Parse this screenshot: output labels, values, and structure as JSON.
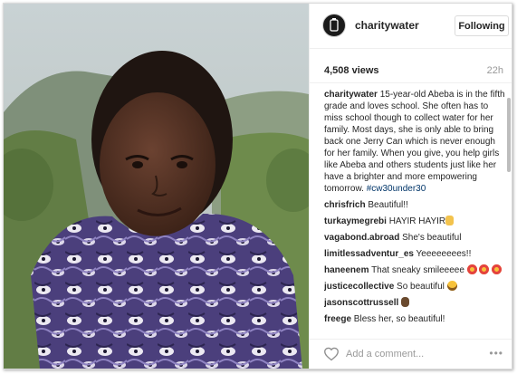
{
  "post": {
    "username": "charitywater",
    "follow_label": "Following",
    "views": "4,508 views",
    "time": "22h",
    "caption_user": "charitywater",
    "caption_text": "15-year-old Abeba is in the fifth grade and loves school. She often has to miss school though to collect water for her family. Most days, she is only able to bring back one Jerry Can which is never enough for her family. When you give, you help girls like Abeba and others students just like her have a brighter and more empowering tomorrow.",
    "caption_hashtag": "#cw30under30"
  },
  "comments": [
    {
      "user": "chrisfrich",
      "text": "Beautiful!!",
      "emoji": ""
    },
    {
      "user": "turkaymegrebi",
      "text": "HAYIR HAYIR",
      "emoji": "hand-emoji"
    },
    {
      "user": "vagabond.abroad",
      "text": "She's beautiful",
      "emoji": ""
    },
    {
      "user": "limitlessadventur_es",
      "text": "Yeeeeeeees!!",
      "emoji": ""
    },
    {
      "user": "haneenem",
      "text": "That sneaky smileeeee",
      "emoji": "heart-eyes-emoji"
    },
    {
      "user": "justicecollective",
      "text": "So beautiful",
      "emoji": "grin-emoji"
    },
    {
      "user": "jasonscottrussell",
      "text": "",
      "emoji": "ok-hand-emoji"
    },
    {
      "user": "freege",
      "text": "Bless her, so beautiful!",
      "emoji": ""
    }
  ],
  "footer": {
    "add_comment_placeholder": "Add a comment...",
    "more_label": "•••"
  },
  "icons": {
    "like": "heart-outline-icon",
    "more": "ellipsis-icon",
    "avatar": "jerry-can-logo"
  },
  "colors": {
    "hashtag": "#003569",
    "border": "#dbdbdb",
    "muted": "#999999"
  }
}
